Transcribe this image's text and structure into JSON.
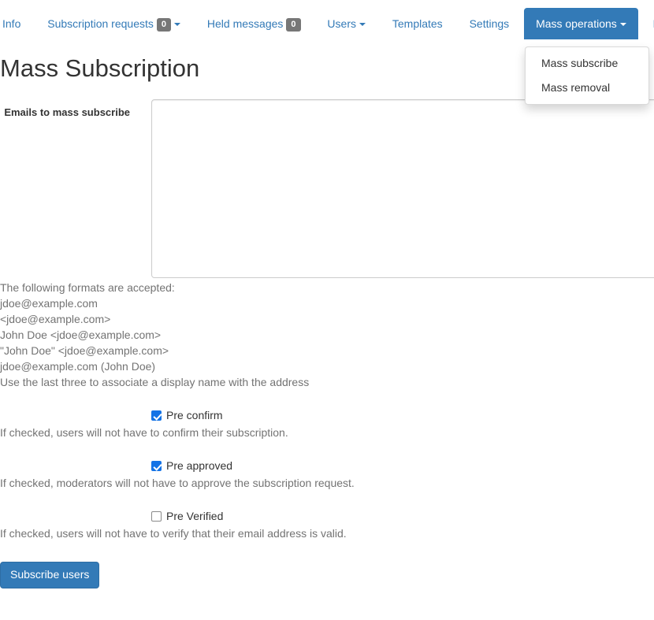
{
  "nav": {
    "items": [
      {
        "label": "Info",
        "badge": null,
        "caret": false,
        "active": false
      },
      {
        "label": "Subscription requests",
        "badge": "0",
        "caret": true,
        "active": false
      },
      {
        "label": "Held messages",
        "badge": "0",
        "caret": false,
        "active": false
      },
      {
        "label": "Users",
        "badge": null,
        "caret": true,
        "active": false
      },
      {
        "label": "Templates",
        "badge": null,
        "caret": false,
        "active": false
      },
      {
        "label": "Settings",
        "badge": null,
        "caret": false,
        "active": false
      },
      {
        "label": "Mass operations",
        "badge": null,
        "caret": true,
        "active": true
      },
      {
        "label": "B",
        "badge": null,
        "caret": false,
        "active": false
      }
    ]
  },
  "dropdown": {
    "items": [
      {
        "label": "Mass subscribe"
      },
      {
        "label": "Mass removal"
      }
    ]
  },
  "page": {
    "title": "Mass Subscription"
  },
  "form": {
    "emails_label": "Emails to mass subscribe",
    "emails_value": "",
    "emails_placeholder": "",
    "help": {
      "intro": "The following formats are accepted:",
      "lines": [
        "jdoe@example.com",
        "<jdoe@example.com>",
        "John Doe <jdoe@example.com>",
        "\"John Doe\" <jdoe@example.com>",
        "jdoe@example.com (John Doe)",
        "Use the last three to associate a display name with the address"
      ]
    },
    "checkboxes": [
      {
        "label": "Pre confirm",
        "checked": true,
        "help": "If checked, users will not have to confirm their subscription."
      },
      {
        "label": "Pre approved",
        "checked": true,
        "help": "If checked, moderators will not have to approve the subscription request."
      },
      {
        "label": "Pre Verified",
        "checked": false,
        "help": "If checked, users will not have to verify that their email address is valid."
      }
    ],
    "submit_label": "Subscribe users"
  },
  "colors": {
    "primary": "#337ab7",
    "link": "#337ab7",
    "badge_bg": "#777777",
    "checkbox_checked": "#1473e6",
    "help_text": "#737373"
  }
}
